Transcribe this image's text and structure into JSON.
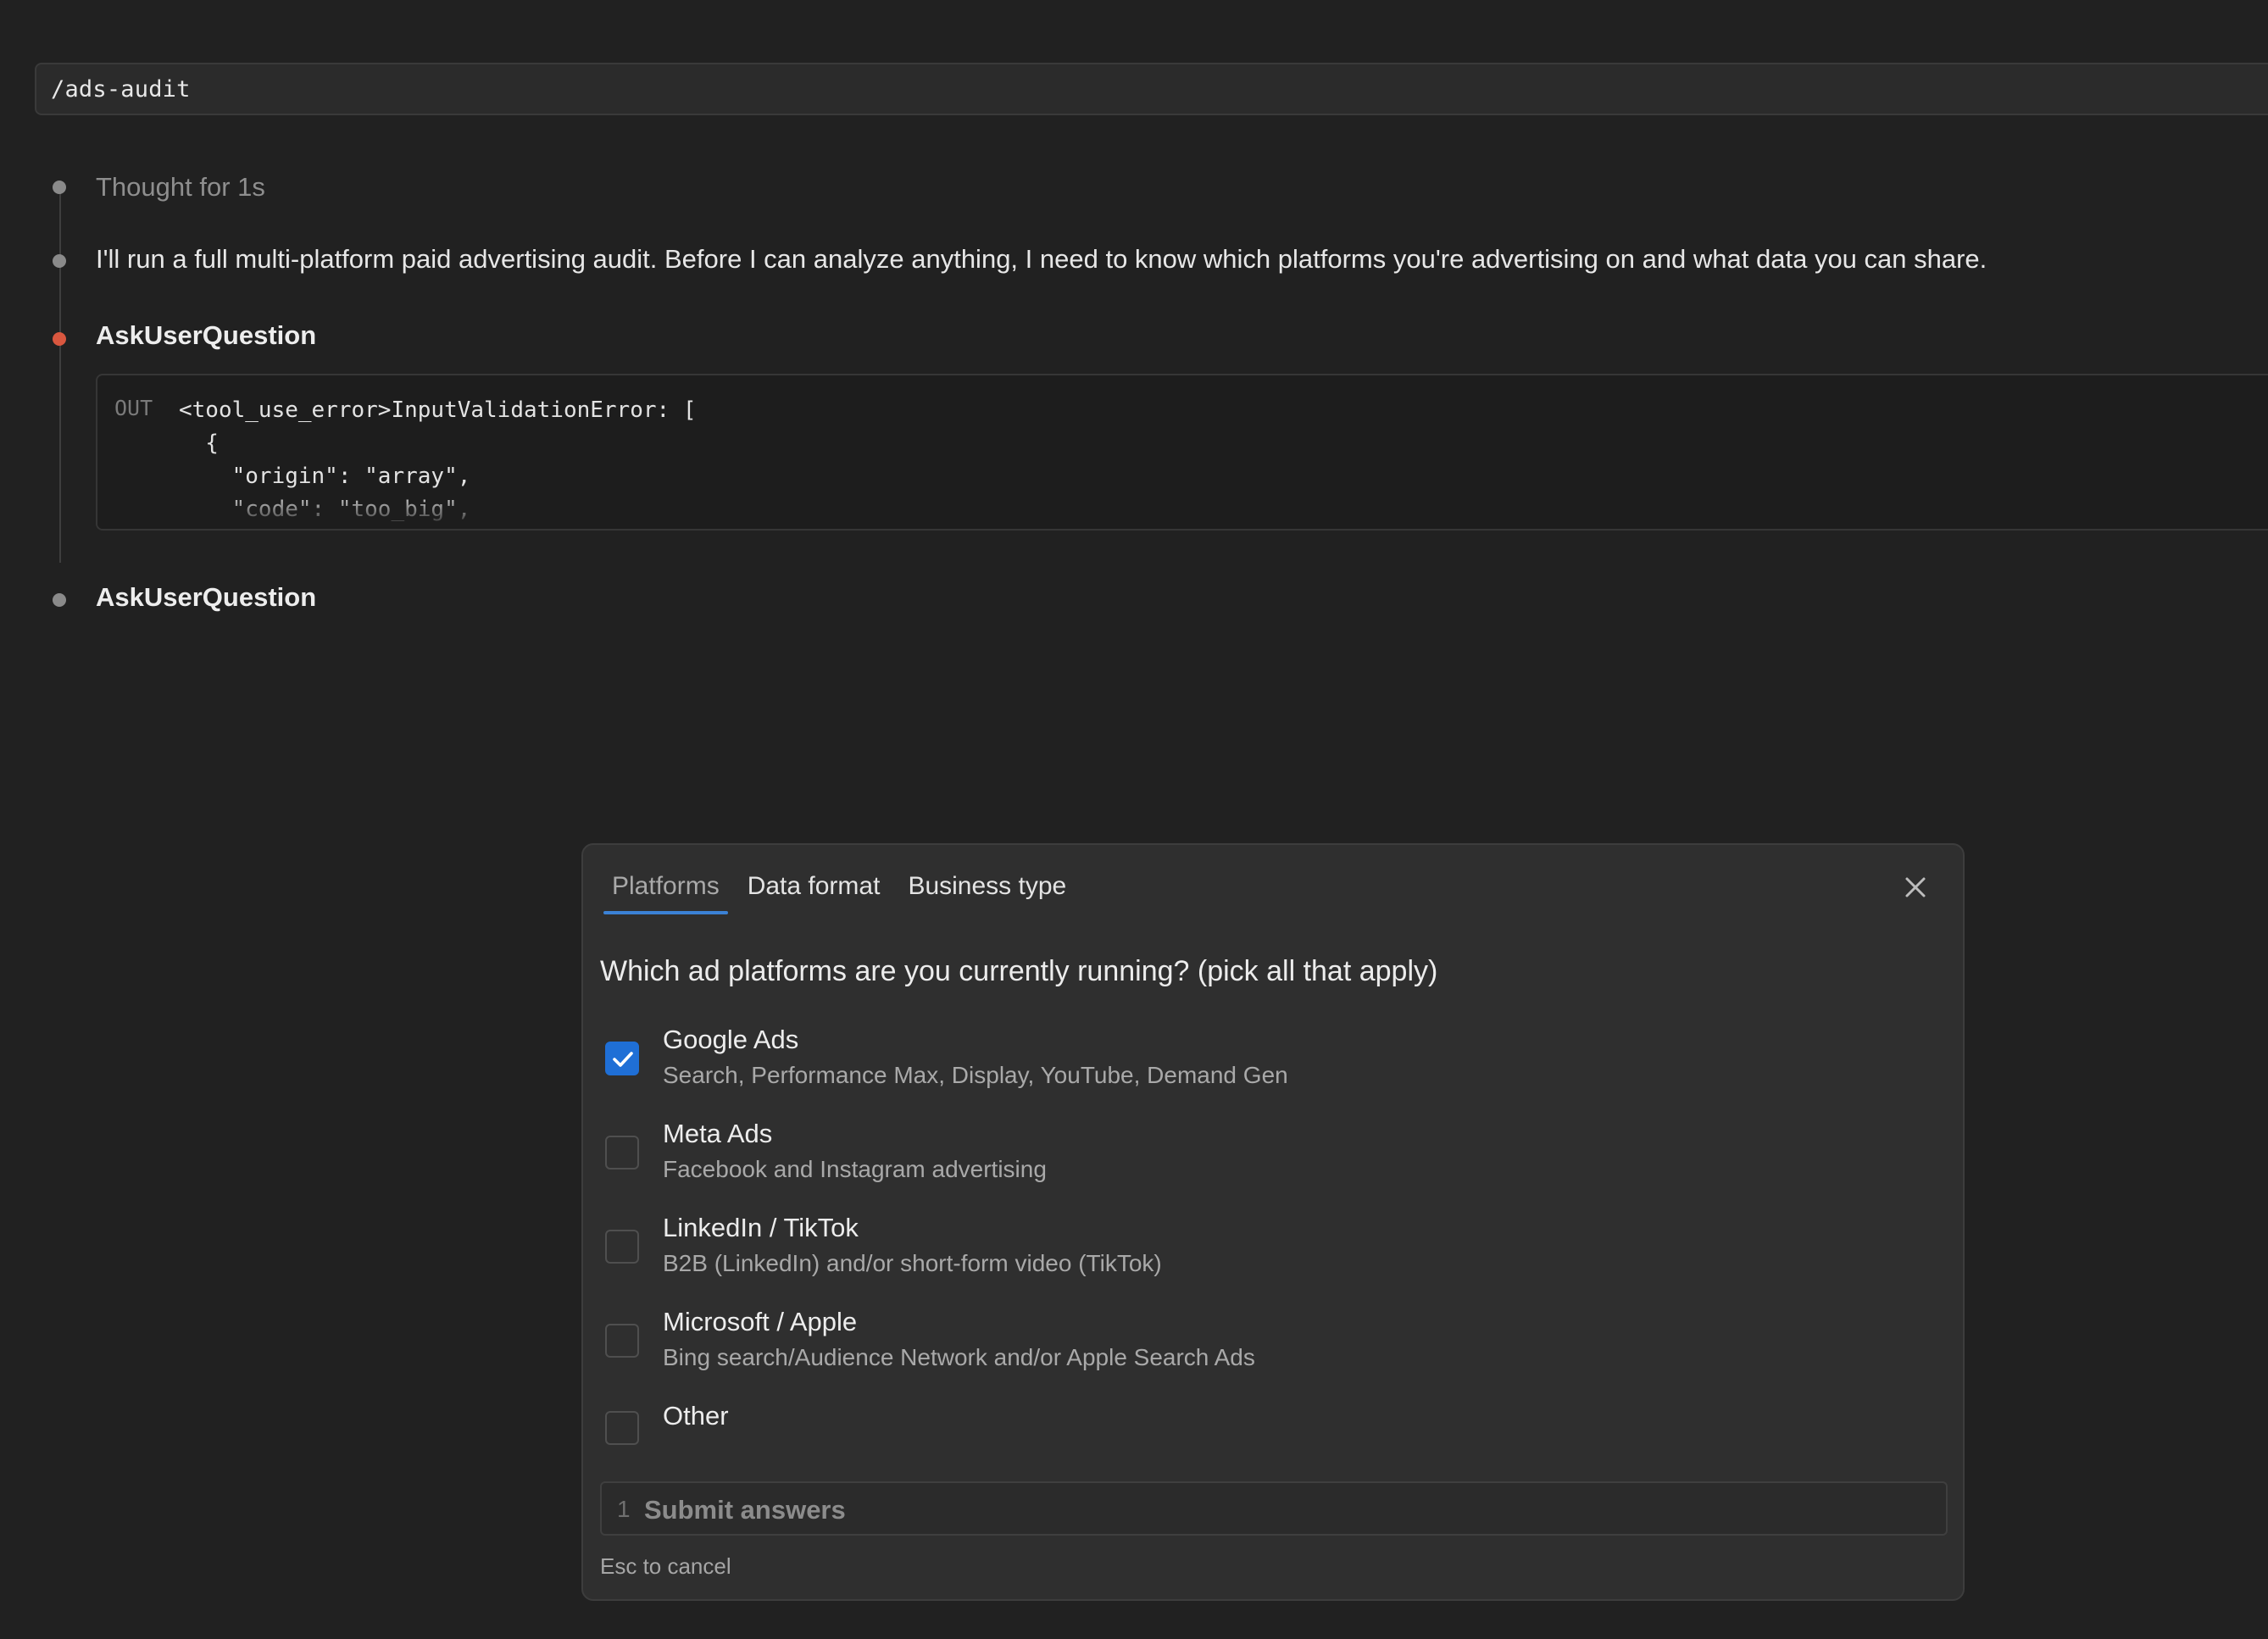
{
  "command": {
    "text": "/ads-audit"
  },
  "timeline": {
    "thought": "Thought for 1s",
    "message": "I'll run a full multi-platform paid advertising audit. Before I can analyze anything, I need to know which platforms you're advertising on and what data you can share.",
    "tool_call_1": {
      "title": "AskUserQuestion",
      "status_color": "#d9573f",
      "out_label": "OUT",
      "code": "<tool_use_error>InputValidationError: [\n  {\n    \"origin\": \"array\",\n    \"code\": \"too_big\","
    },
    "tool_call_2": {
      "title": "AskUserQuestion"
    }
  },
  "dialog": {
    "tabs": [
      {
        "label": "Platforms",
        "active": true
      },
      {
        "label": "Data format",
        "active": false
      },
      {
        "label": "Business type",
        "active": false
      }
    ],
    "close_icon": "close-icon",
    "question": "Which ad platforms are you currently running? (pick all that apply)",
    "options": [
      {
        "label": "Google Ads",
        "description": "Search, Performance Max, Display, YouTube, Demand Gen",
        "checked": true
      },
      {
        "label": "Meta Ads",
        "description": "Facebook and Instagram advertising",
        "checked": false
      },
      {
        "label": "LinkedIn / TikTok",
        "description": "B2B (LinkedIn) and/or short-form video (TikTok)",
        "checked": false
      },
      {
        "label": "Microsoft / Apple",
        "description": "Bing search/Audience Network and/or Apple Search Ads",
        "checked": false
      },
      {
        "label": "Other",
        "description": "",
        "checked": false
      }
    ],
    "submit": {
      "number": "1",
      "label": "Submit answers"
    },
    "esc_hint": "Esc to cancel",
    "accent_color": "#1f6fd6"
  }
}
